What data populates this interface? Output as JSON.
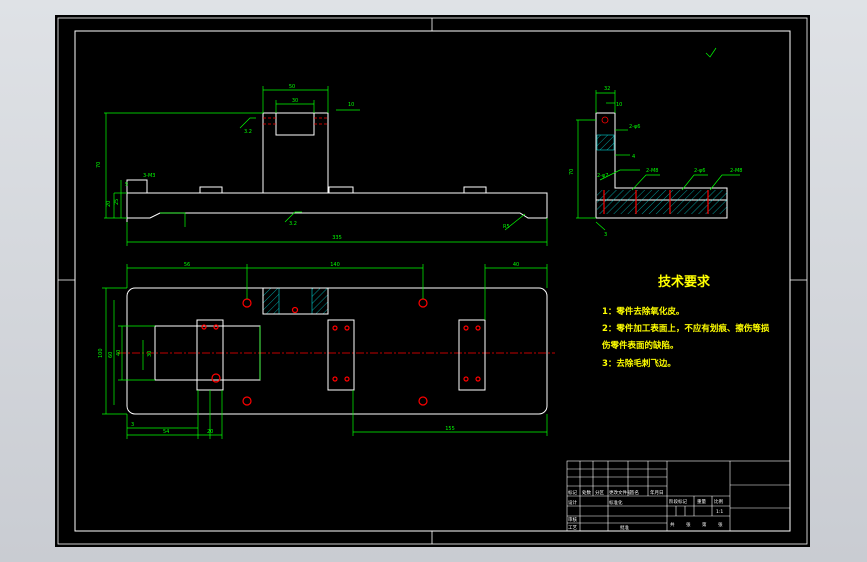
{
  "colors": {
    "background": "#000000",
    "viewport": "#d4d7dc",
    "frame": "#ffffff",
    "dimension": "#00ff00",
    "hatch": "#00ffff",
    "hole": "#ff0000",
    "centerline": "#ff0000",
    "text": "#ffff00",
    "title_text": "#00ff00"
  },
  "front_view": {
    "dims": {
      "top_width": "50",
      "slot_width": "30",
      "angle_top": "10",
      "height_total": "70",
      "left_a": "20",
      "left_b": "25",
      "left_c": "5",
      "hole_label": "3-M3",
      "length_total": "335",
      "roughness_1": "3.2",
      "roughness_2": "3.2",
      "radius": "R5"
    }
  },
  "side_view": {
    "dims": {
      "top": "32",
      "offset": "10",
      "height": "70",
      "hole_a": "2-φ6",
      "hole_b": "2-M8",
      "hole_c": "2-φ6",
      "hole_d": "2-M8",
      "left_hole": "2-φ7",
      "notch": "4",
      "bottom": "3"
    }
  },
  "top_view": {
    "dims": {
      "left_offset": "56",
      "middle_span": "140",
      "right_offset": "40",
      "height_total": "100",
      "inner_a": "60",
      "inner_b": "40",
      "inner_c": "30",
      "bottom_a": "54",
      "bottom_b": "20",
      "bottom_c": "3",
      "bottom_span": "155"
    }
  },
  "tech_requirements": {
    "title": "技术要求",
    "lines": [
      "1：零件去除氧化皮。",
      "2：零件加工表面上，不应有划痕、擦伤等损",
      "伤零件表面的缺陷。",
      "3：去除毛刺飞边。"
    ]
  },
  "title_block": {
    "row_labels": [
      "标记",
      "处数",
      "分区",
      "更改文件号",
      "签名",
      "年月日"
    ],
    "design": "设计",
    "standard": "标准化",
    "stage": "阶段标记",
    "weight": "重量",
    "scale": "比例",
    "scale_value": "1:1",
    "review": "审核",
    "process": "工艺",
    "approve": "批准",
    "sheet_info": [
      "共",
      "张",
      "第",
      "张"
    ]
  }
}
